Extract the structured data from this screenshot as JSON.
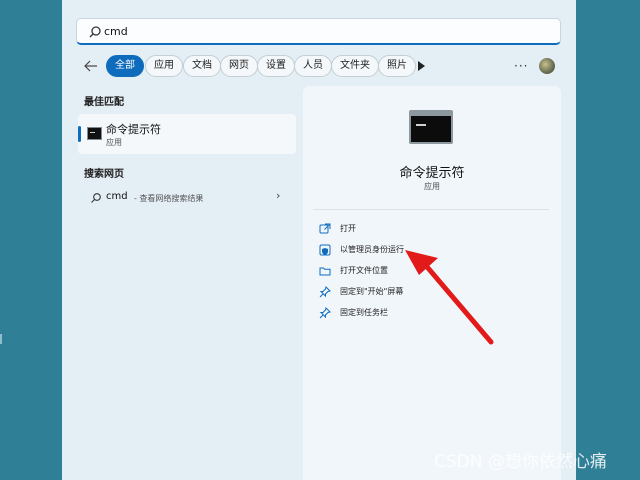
{
  "search": {
    "value": "cmd"
  },
  "filters": [
    {
      "label": "全部",
      "active": true
    },
    {
      "label": "应用"
    },
    {
      "label": "文档"
    },
    {
      "label": "网页"
    },
    {
      "label": "设置"
    },
    {
      "label": "人员"
    },
    {
      "label": "文件夹"
    },
    {
      "label": "照片"
    }
  ],
  "more_label": "···",
  "best_match": {
    "heading": "最佳匹配",
    "name": "命令提示符",
    "type": "应用"
  },
  "web_search": {
    "heading": "搜索网页",
    "query": "cmd",
    "description": "- 查看网络搜索结果"
  },
  "detail": {
    "title": "命令提示符",
    "type": "应用",
    "actions": [
      {
        "label": "打开",
        "icon": "open-external-icon"
      },
      {
        "label": "以管理员身份运行",
        "icon": "shield-admin-icon"
      },
      {
        "label": "打开文件位置",
        "icon": "folder-icon"
      },
      {
        "label": "固定到\"开始\"屏幕",
        "icon": "pin-icon"
      },
      {
        "label": "固定到任务栏",
        "icon": "pin-icon"
      }
    ]
  },
  "watermark": "CSDN @想你依然心痛",
  "colors": {
    "accent": "#0f6cbd",
    "arrow": "#e21a1a",
    "desktop": "#2f7f97"
  }
}
